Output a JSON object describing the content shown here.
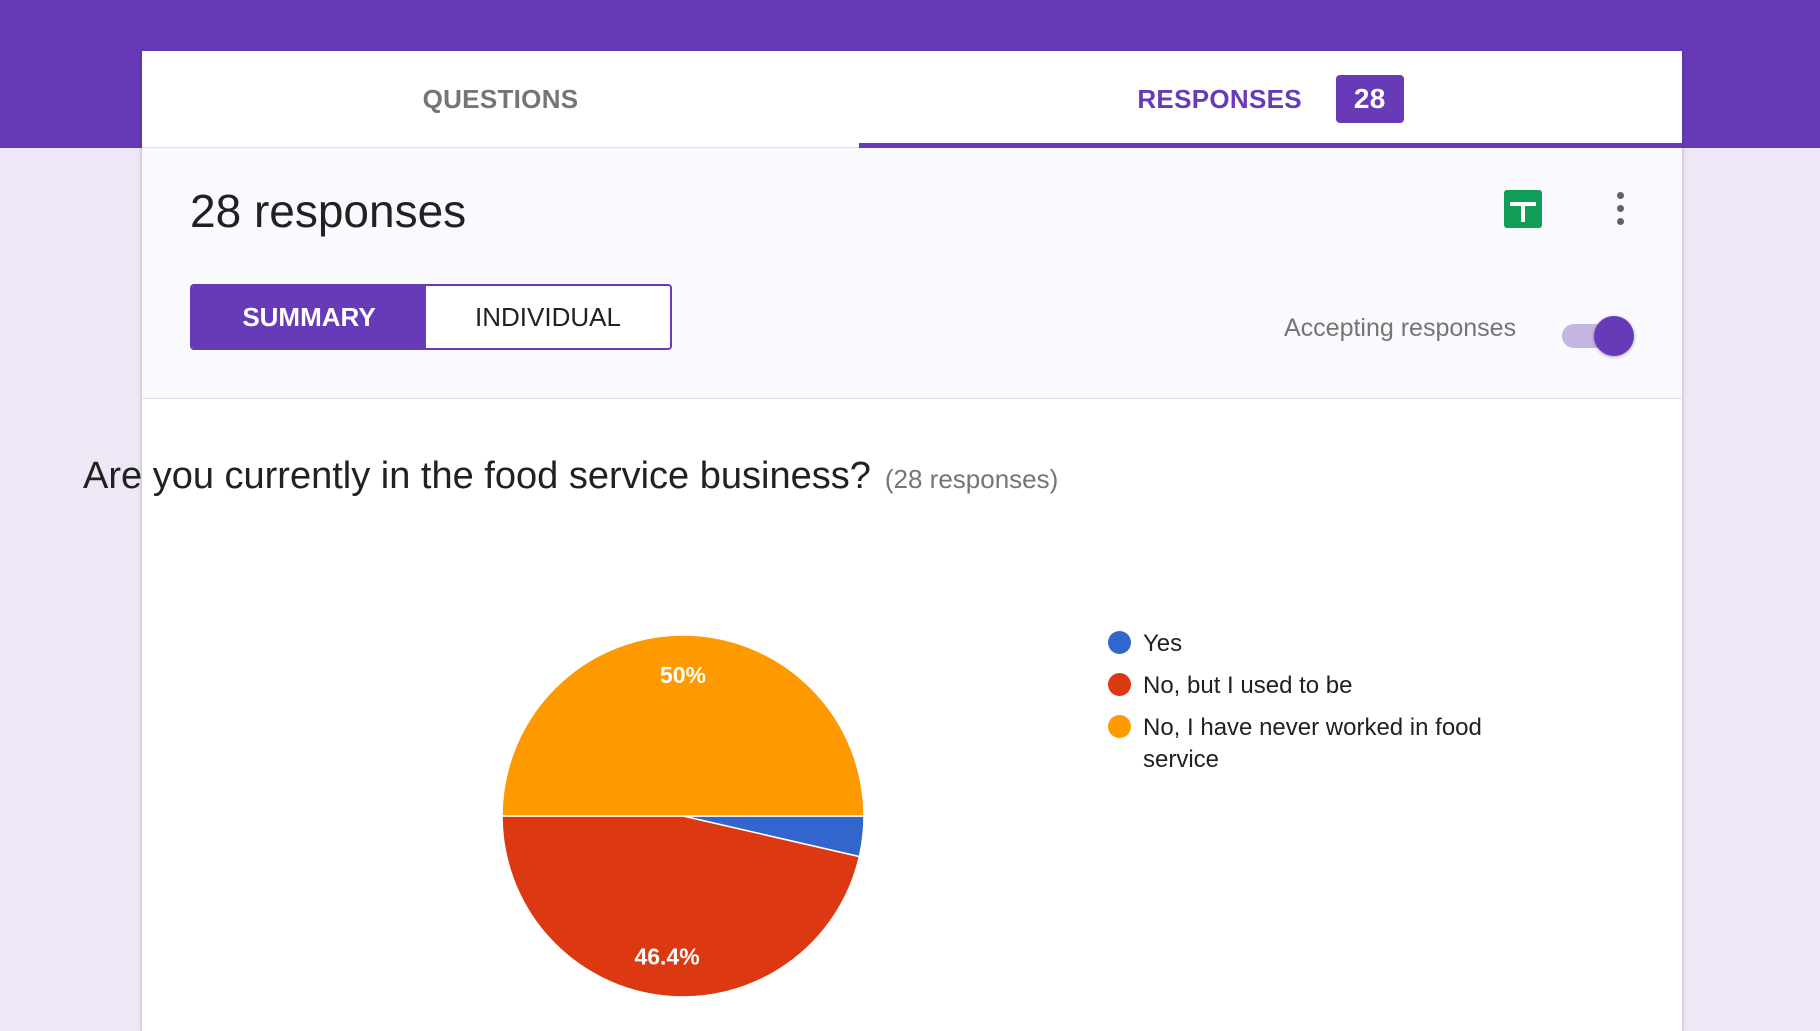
{
  "tabs": {
    "questions_label": "QUESTIONS",
    "responses_label": "RESPONSES",
    "responses_count": "28"
  },
  "summary": {
    "title": "28 responses",
    "summary_button": "SUMMARY",
    "individual_button": "INDIVIDUAL",
    "accepting_label": "Accepting responses",
    "accepting_on": true
  },
  "question": {
    "text": "Are you currently in the food service business?",
    "count_text": "(28 responses)"
  },
  "colors": {
    "brand": "#673ab7",
    "yes": "#3366cc",
    "used_to_be": "#dc3912",
    "never": "#ff9900",
    "sheets_green": "#0f9d58"
  },
  "icons": {
    "sheets": "sheets-icon",
    "more": "more-vert-icon"
  },
  "chart_data": {
    "type": "pie",
    "title": "",
    "slices": [
      {
        "label": "Yes",
        "value": 3.6,
        "color": "#3366cc",
        "display": ""
      },
      {
        "label": "No, but I used to be",
        "value": 46.4,
        "color": "#dc3912",
        "display": "46.4%"
      },
      {
        "label": "No, I have never worked in food service",
        "value": 50.0,
        "color": "#ff9900",
        "display": "50%"
      }
    ],
    "legend_placement": "right"
  }
}
